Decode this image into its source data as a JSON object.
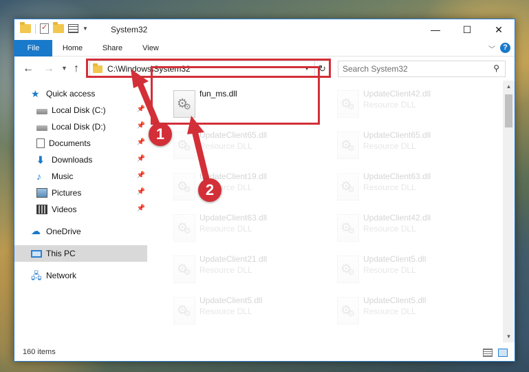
{
  "window": {
    "title": "System32",
    "controls": [
      "—",
      "☐",
      "✕"
    ]
  },
  "ribbon": {
    "tabs": [
      "File",
      "Home",
      "Share",
      "View"
    ]
  },
  "navigation": {
    "address_path": "C:\\Windows\\System32",
    "search_placeholder": "Search System32"
  },
  "sidebar": {
    "items": [
      {
        "label": "Quick access",
        "icon": "star-icon"
      },
      {
        "label": "Local Disk (C:)",
        "icon": "disk-icon",
        "pinned": true
      },
      {
        "label": "Local Disk (D:)",
        "icon": "disk-icon",
        "pinned": true
      },
      {
        "label": "Documents",
        "icon": "documents-icon",
        "pinned": true
      },
      {
        "label": "Downloads",
        "icon": "download-icon",
        "pinned": true
      },
      {
        "label": "Music",
        "icon": "music-icon",
        "pinned": true
      },
      {
        "label": "Pictures",
        "icon": "pictures-icon",
        "pinned": true
      },
      {
        "label": "Videos",
        "icon": "videos-icon",
        "pinned": true
      },
      {
        "label": "OneDrive",
        "icon": "cloud-icon"
      },
      {
        "label": "This PC",
        "icon": "pc-icon",
        "selected": true
      },
      {
        "label": "Network",
        "icon": "network-icon"
      }
    ]
  },
  "files": [
    {
      "name": "fun_ms.dll",
      "type": ""
    },
    {
      "name": "UpdateClient42.dll",
      "type": "Resource DLL"
    },
    {
      "name": "UpdateClient65.dll",
      "type": "Resource DLL"
    },
    {
      "name": "UpdateClient65.dll",
      "type": "Resource DLL"
    },
    {
      "name": "UpdateClient19.dll",
      "type": "Resource DLL"
    },
    {
      "name": "UpdateClient63.dll",
      "type": "Resource DLL"
    },
    {
      "name": "UpdateClient63.dll",
      "type": "Resource DLL"
    },
    {
      "name": "UpdateClient42.dll",
      "type": "Resource DLL"
    },
    {
      "name": "UpdateClient21.dll",
      "type": "Resource DLL"
    },
    {
      "name": "UpdateClient5.dll",
      "type": "Resource DLL"
    },
    {
      "name": "UpdateClient5.dll",
      "type": "Resource DLL"
    },
    {
      "name": "UpdateClient5.dll",
      "type": "Resource DLL"
    }
  ],
  "status": {
    "item_count": "160 items"
  },
  "callouts": {
    "step1": "1",
    "step2": "2",
    "color": "#d32f38"
  }
}
